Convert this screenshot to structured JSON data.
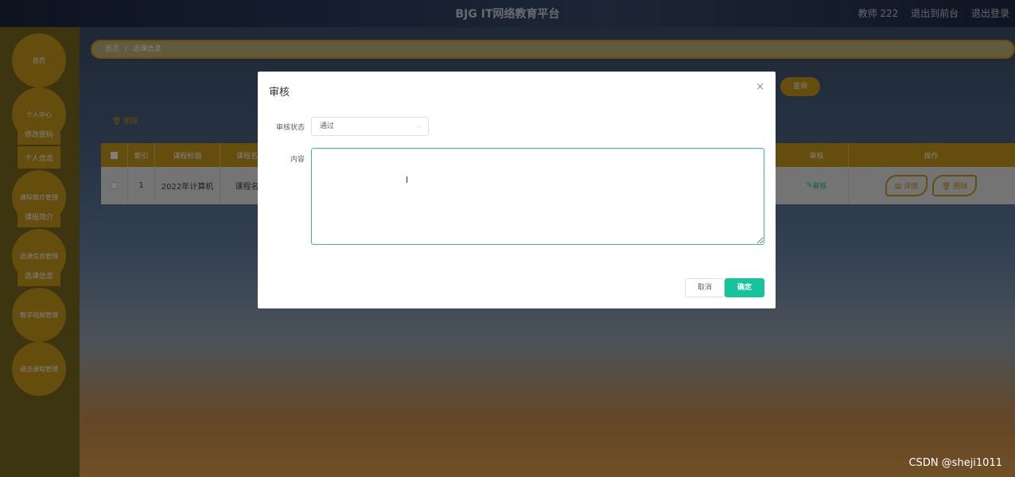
{
  "header": {
    "title": "BJG IT网络教育平台",
    "user": "教师 222",
    "back_front": "退出到前台",
    "logout": "退出登录"
  },
  "sidebar": {
    "items": [
      {
        "label": "首页"
      },
      {
        "label": "个人中心"
      },
      {
        "label": "修改密码"
      },
      {
        "label": "个人信息"
      },
      {
        "label": "课程简介管理"
      },
      {
        "label": "课程简介"
      },
      {
        "label": "选课信息管理"
      },
      {
        "label": "选课信息"
      },
      {
        "label": "教学视频管理"
      },
      {
        "label": "退选课程管理"
      }
    ]
  },
  "breadcrumb": {
    "home": "首页",
    "separator": "/",
    "current": "选课信息"
  },
  "toolbar": {
    "query": "查询",
    "delete": "删除"
  },
  "table": {
    "headers": [
      "索引",
      "课程标题",
      "课程名",
      "审核",
      "操作"
    ],
    "row": {
      "index": "1",
      "course_title": "2022年计算机",
      "course_name": "课程名",
      "review": "审核",
      "detail": "详情",
      "delete": "删除"
    }
  },
  "dialog": {
    "title": "审核",
    "close": "×",
    "status_label": "审核状态",
    "status_value": "通过",
    "content_label": "内容",
    "content_value": "",
    "cancel": "取消",
    "confirm": "确定"
  },
  "watermark": "CSDN @sheji1011",
  "colors": {
    "accent": "#c89a1a",
    "primary": "#17c39b"
  }
}
